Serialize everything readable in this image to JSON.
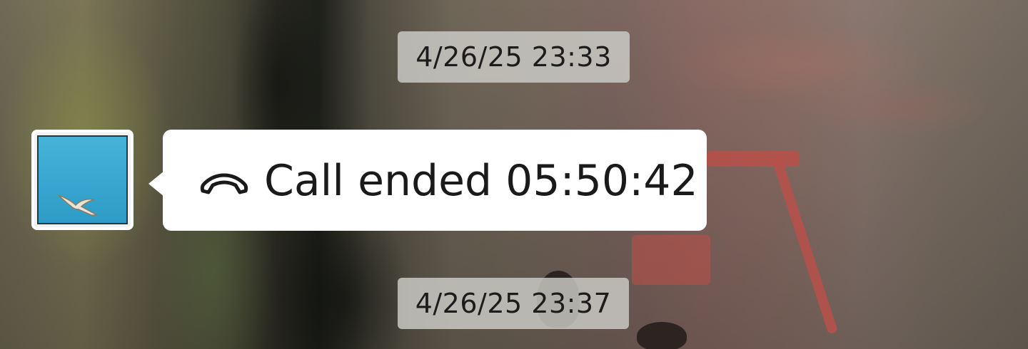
{
  "chat": {
    "timestamps": [
      "4/26/25 23:33",
      "4/26/25 23:37"
    ],
    "message": {
      "icon": "hang-up-phone-icon",
      "text": "Call ended 05:50:42"
    },
    "avatar": {
      "icon": "seagull-sky-avatar"
    }
  }
}
